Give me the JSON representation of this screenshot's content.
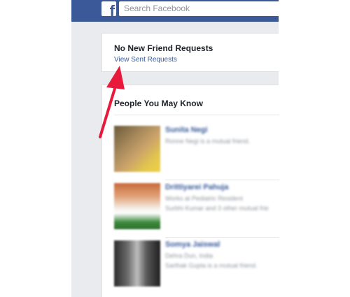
{
  "header": {
    "logo_letter": "f",
    "search_placeholder": "Search Facebook"
  },
  "friend_requests": {
    "title": "No New Friend Requests",
    "link": "View Sent Requests"
  },
  "pymk": {
    "title": "People You May Know",
    "people": [
      {
        "name": "Sunita Negi",
        "line1": "Ronne Negi is a mutual friend.",
        "line2": ""
      },
      {
        "name": "Drittiyarei Pahuja",
        "line1": "Works at Pediatric Resident",
        "line2": "Surbhi Kumar and 3 other mutual frie"
      },
      {
        "name": "Somya Jaiswal",
        "line1": "Dehra Dun, India",
        "line2": "Sarthak Gupta is a mutual friend."
      }
    ]
  },
  "annotation": {
    "arrow_color": "#e8193a"
  }
}
